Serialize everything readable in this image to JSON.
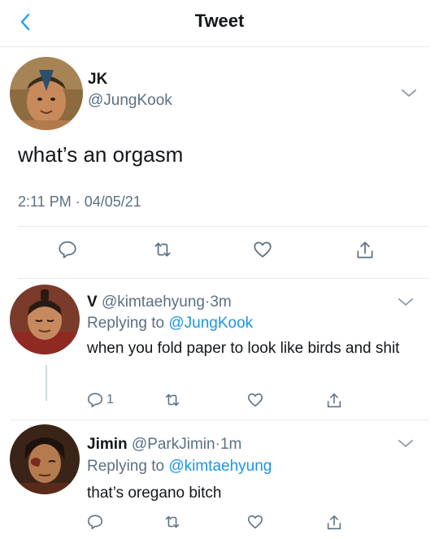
{
  "header": {
    "title": "Tweet",
    "back_icon": "chevron-left-icon",
    "accent": "#1da1f2"
  },
  "main_tweet": {
    "name": "JK",
    "handle": "@JungKook",
    "text": "what’s an orgasm",
    "time": "2:11 PM",
    "separator": "·",
    "date": "04/05/21",
    "actions": [
      "reply-icon",
      "retweet-icon",
      "like-icon",
      "share-icon"
    ]
  },
  "replies": [
    {
      "name": "V",
      "handle": "@kimtaehyung",
      "separator": "·",
      "age": "3m",
      "replying_label": "Replying to",
      "replying_to": "@JungKook",
      "text": "when you fold paper to look like birds and shit",
      "reply_count": "1"
    },
    {
      "name": "Jimin",
      "handle": "@ParkJimin",
      "separator": "·",
      "age": "1m",
      "replying_label": "Replying to",
      "replying_to": "@kimtaehyung",
      "text": "that’s oregano bitch",
      "reply_count": ""
    }
  ],
  "colors": {
    "link": "#1b95e0",
    "secondary_text": "#5b7083",
    "primary_text": "#14171a",
    "divider": "#e6ecf0"
  }
}
